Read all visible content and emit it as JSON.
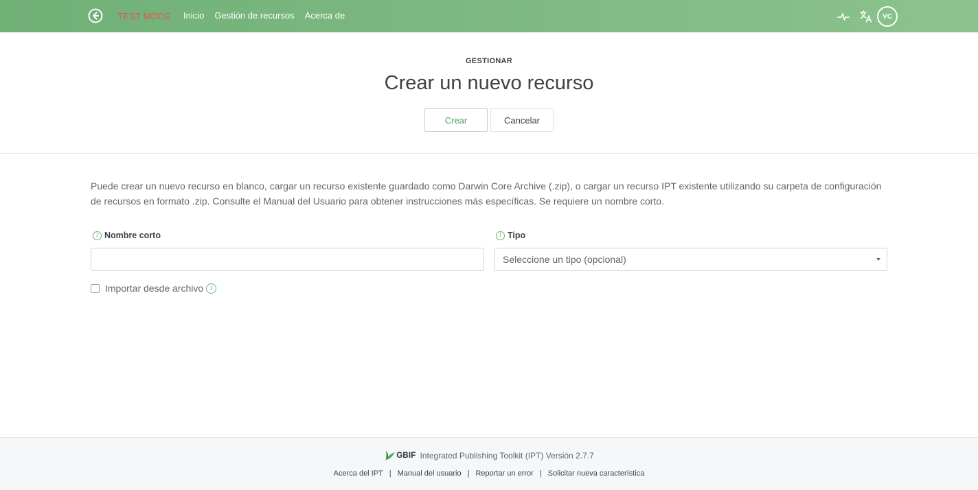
{
  "navbar": {
    "test_mode": "TEST MODE",
    "links": [
      "Inicio",
      "Gestión de recursos",
      "Acerca de"
    ],
    "avatar_initials": "VC",
    "colors": {
      "bar_start": "#6fb077",
      "bar_end": "#8cc28e",
      "test_mode": "#e8524a"
    },
    "icons": [
      "logo-icon",
      "health-pulse-icon",
      "translate-icon"
    ]
  },
  "header": {
    "eyebrow": "GESTIONAR",
    "title": "Crear un nuevo recurso",
    "create_label": "Crear",
    "cancel_label": "Cancelar"
  },
  "form": {
    "intro": "Puede crear un nuevo recurso en blanco, cargar un recurso existente guardado como Darwin Core Archive (.zip), o cargar un recurso IPT existente utilizando su carpeta de configuración de recursos en formato .zip. Consulte el Manual del Usuario para obtener instrucciones más específicas. Se requiere un nombre corto.",
    "shortname_label": "Nombre corto",
    "shortname_value": "",
    "type_label": "Tipo",
    "type_selected": "Seleccione un tipo (opcional)",
    "import_label": "Importar desde archivo",
    "import_checked": false
  },
  "footer": {
    "brand": "GBIF",
    "version_text": "Integrated Publishing Toolkit (IPT) Versión 2.7.7",
    "links": [
      "Acerca del IPT",
      "Manual del usuario",
      "Reportar un error",
      "Solicitar nueva característica"
    ],
    "separator": "|"
  }
}
